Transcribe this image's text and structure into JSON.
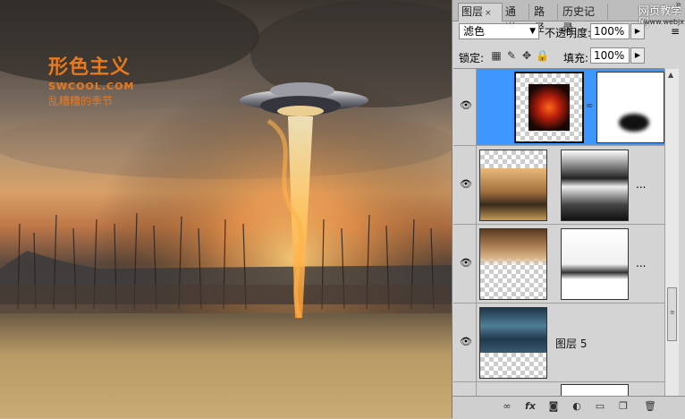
{
  "canvas": {
    "brand_logo": "形色主义",
    "brand_site": "SWCOOL.COM",
    "brand_sub": "乱糟糟的季节"
  },
  "panel": {
    "tabs": [
      {
        "label": "图层",
        "active": true,
        "close": "×"
      },
      {
        "label": "通道",
        "active": false
      },
      {
        "label": "路径",
        "active": false
      },
      {
        "label": "历史记录",
        "active": false
      }
    ],
    "watermark": "网页教学网",
    "watermark_url": "www.webjx.com",
    "blend_mode": "滤色",
    "opacity_label": "不透明度:",
    "opacity_value": "100%",
    "lock_label": "锁定:",
    "fill_label": "填充:",
    "fill_value": "100%",
    "layers": [
      {
        "name": "",
        "selected": true,
        "visible": true,
        "icon_eye": "eye-icon",
        "chain": true
      },
      {
        "name": "",
        "selected": false,
        "visible": true,
        "icon_eye": "eye-icon",
        "more": "..."
      },
      {
        "name": "",
        "selected": false,
        "visible": true,
        "icon_eye": "eye-icon",
        "more": "..."
      },
      {
        "name": "图层 5",
        "selected": false,
        "visible": true,
        "icon_eye": "eye-icon"
      }
    ],
    "bottom_icons": [
      "link-icon",
      "fx-icon",
      "mask-icon",
      "adjustment-icon",
      "group-icon",
      "new-layer-icon",
      "trash-icon"
    ],
    "colors": {
      "selection": "#3d97ff",
      "panel_bg": "#d4d4d4",
      "brand": "#e9791d"
    }
  }
}
